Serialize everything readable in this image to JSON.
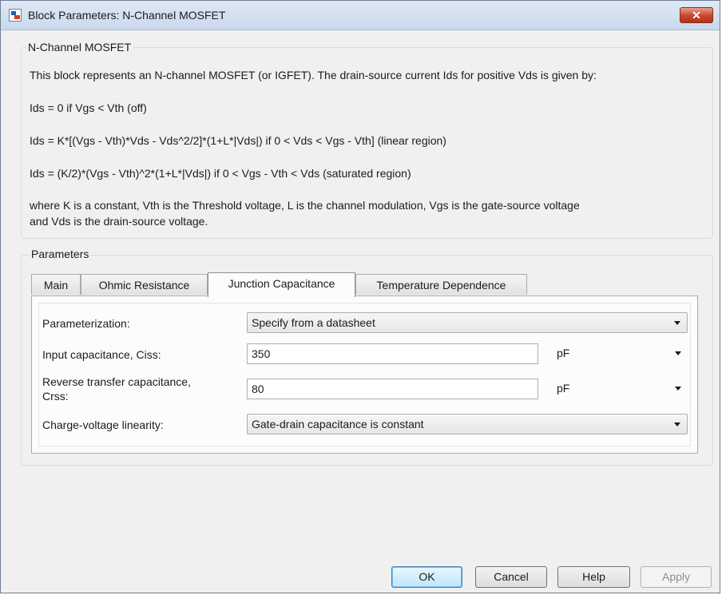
{
  "window": {
    "title": "Block Parameters: N-Channel MOSFET",
    "close_label": "✕"
  },
  "description": {
    "group_label": "N-Channel MOSFET",
    "lines": [
      "This block represents an N-channel MOSFET (or IGFET). The drain-source current Ids for positive Vds is given by:",
      "Ids = 0 if Vgs < Vth (off)",
      "Ids = K*[(Vgs - Vth)*Vds - Vds^2/2]*(1+L*|Vds|) if 0 < Vds < Vgs - Vth] (linear region)",
      "Ids = (K/2)*(Vgs - Vth)^2*(1+L*|Vds|) if 0 < Vgs - Vth < Vds (saturated region)",
      "where K is a constant, Vth is the Threshold voltage, L is the channel modulation, Vgs is the gate-source voltage",
      "and Vds is the drain-source voltage."
    ]
  },
  "parameters": {
    "group_label": "Parameters",
    "tabs": [
      {
        "label": "Main"
      },
      {
        "label": "Ohmic Resistance"
      },
      {
        "label": "Junction Capacitance",
        "active": true
      },
      {
        "label": "Temperature Dependence"
      }
    ],
    "fields": {
      "parameterization": {
        "label": "Parameterization:",
        "value": "Specify from a datasheet"
      },
      "ciss": {
        "label": "Input capacitance, Ciss:",
        "value": "350",
        "unit": "pF"
      },
      "crss": {
        "label_line1": "Reverse transfer capacitance,",
        "label_line2": "Crss:",
        "value": "80",
        "unit": "pF"
      },
      "linearity": {
        "label": "Charge-voltage linearity:",
        "value": "Gate-drain capacitance is constant"
      }
    }
  },
  "buttons": {
    "ok": "OK",
    "cancel": "Cancel",
    "help": "Help",
    "apply": "Apply"
  },
  "colors": {
    "close": "#c7452a",
    "default_button_border": "#3c7fb1"
  }
}
